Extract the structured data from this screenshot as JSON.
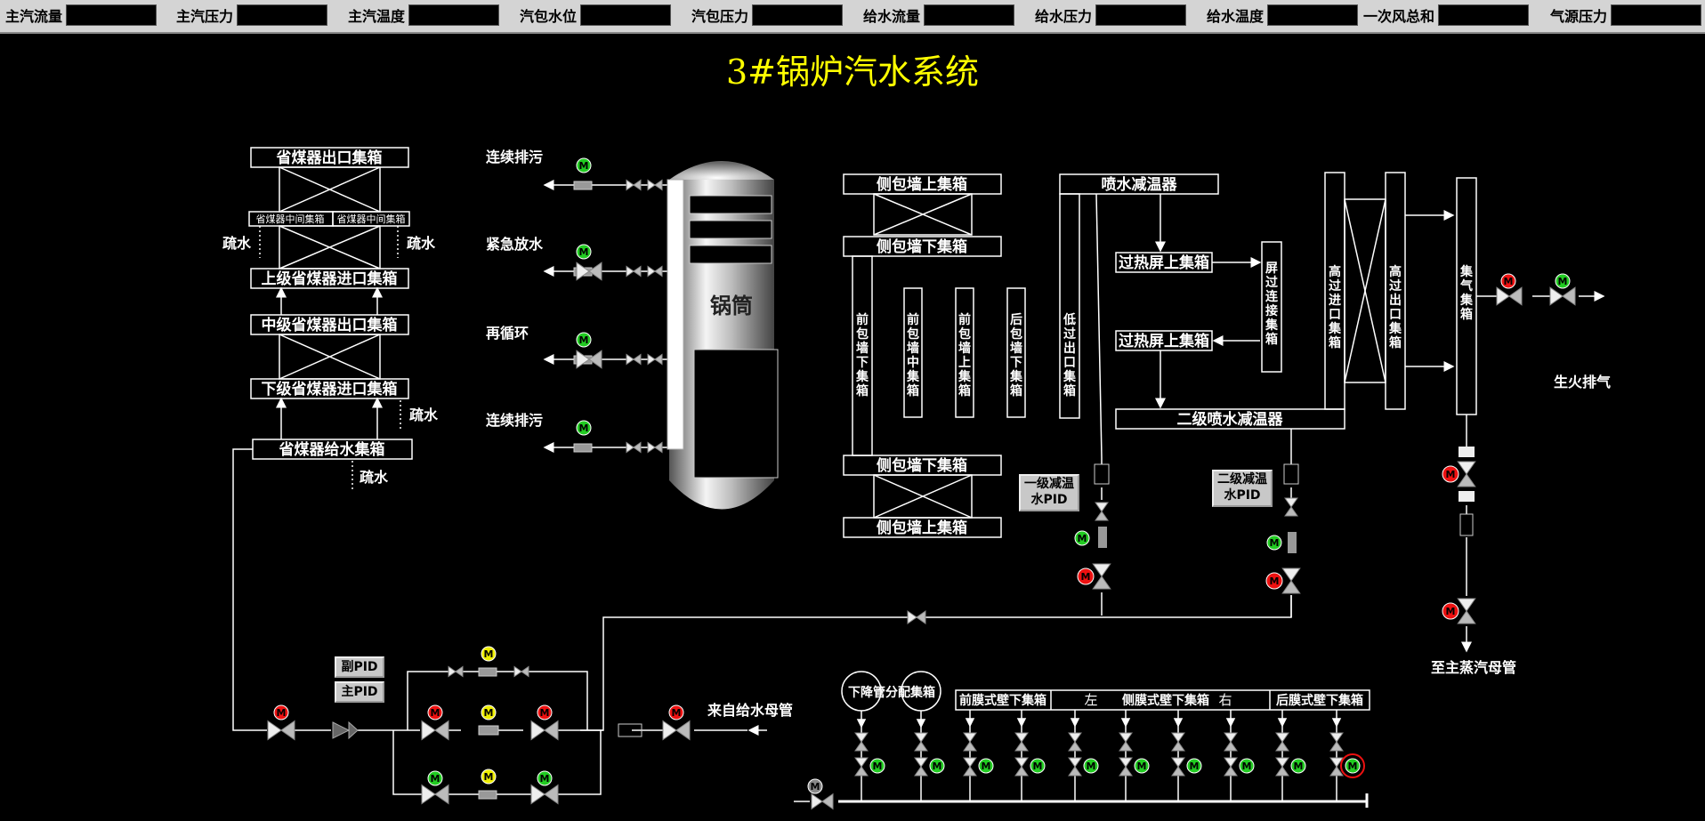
{
  "topbar": {
    "items": [
      {
        "label": "主汽流量"
      },
      {
        "label": "主汽压力"
      },
      {
        "label": "主汽温度"
      },
      {
        "label": "汽包水位"
      },
      {
        "label": "汽包压力"
      },
      {
        "label": "给水流量"
      },
      {
        "label": "给水压力"
      },
      {
        "label": "给水温度"
      },
      {
        "label": "一次风总和"
      },
      {
        "label": "气源压力"
      }
    ]
  },
  "title": "3#锅炉汽水系统",
  "economizer": {
    "outlet_header": "省煤器出口集箱",
    "mid_header_left": "省煤器中间集箱",
    "mid_header_right": "省煤器中间集箱",
    "upper_inlet": "上级省煤器进口集箱",
    "middle_outlet": "中级省煤器出口集箱",
    "lower_inlet": "下级省煤器进口集箱",
    "feed_header": "省煤器给水集箱",
    "drain": "疏水"
  },
  "drum": {
    "label": "锅筒",
    "continuous_blowdown": "连续排污",
    "emergency_drain": "紧急放水",
    "recirculation": "再循环"
  },
  "walls": {
    "side_upper_1": "侧包墙上集箱",
    "side_lower_1": "侧包墙下集箱",
    "side_lower_2": "侧包墙下集箱",
    "side_upper_2": "侧包墙上集箱",
    "front_lower": "前包墙下集箱",
    "front_middle": "前包墙中集箱",
    "front_upper": "前包墙上集箱",
    "rear_lower": "后包墙下集箱",
    "low_sh_outlet": "低过出口集箱"
  },
  "superheater": {
    "spray_desuperheater": "喷水减温器",
    "screen_upper_1": "过热屏上集箱",
    "screen_upper_2": "过热屏上集箱",
    "screen_link": "屏过连接集箱",
    "stage2_spray": "二级喷水减温器",
    "hp_inlet": "高过进口集箱",
    "hp_outlet": "高过出口集箱",
    "steam_header": "集气集箱",
    "pid1": "一级减温水PID",
    "pid2": "二级减温水PID",
    "vent": "生火排气",
    "to_main": "至主蒸汽母管"
  },
  "feedwater": {
    "sub_pid": "副PID",
    "main_pid": "主PID",
    "from_header": "来自给水母管"
  },
  "downcomer": {
    "distribution": "下降管分配集箱",
    "front_membrane": "前膜式壁下集箱",
    "left": "左",
    "side_membrane": "侧膜式壁下集箱",
    "right": "右",
    "rear_membrane": "后膜式壁下集箱"
  },
  "motor_letter": "M",
  "colors": {
    "motor_green": "#22cc22",
    "motor_red": "#ee1111",
    "motor_yellow": "#eeee00",
    "motor_gray": "#888888",
    "title": "#ffff00"
  }
}
